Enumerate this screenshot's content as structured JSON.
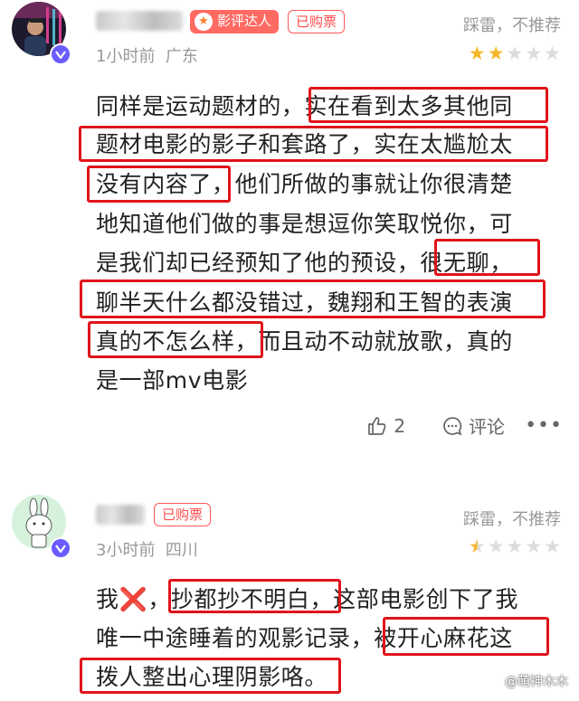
{
  "reviews": [
    {
      "critic_badge": "影评达人",
      "bought_badge": "已购票",
      "time": "1小时前",
      "location": "广东",
      "rating_text": "踩雷，不推荐",
      "stars": [
        1,
        1,
        0,
        0,
        0
      ],
      "lines": [
        "同样是运动题材的，实在看到太多其他同",
        "题材电影的影子和套路了，实在太尴尬太",
        "没有内容了，他们所做的事就让你很清楚",
        "地知道他们做的事是想逗你笑取悦你，可",
        "是我们却已经预知了他的预设，很无聊，",
        "聊半天什么都没错过，魏翔和王智的表演",
        "真的不怎么样，而且动不动就放歌，真的",
        "是一部mv电影"
      ],
      "like_count": "2",
      "comment_label": "评论"
    },
    {
      "bought_badge": "已购票",
      "time": "3小时前",
      "location": "四川",
      "rating_text": "踩雷，不推荐",
      "stars": [
        0.5,
        0,
        0,
        0,
        0
      ],
      "lines": [
        "我❌，抄都抄不明白，这部电影创下了我",
        "唯一中途睡着的观影记录，被开心麻花这",
        "拨人整出心理阴影咯。"
      ]
    }
  ],
  "watermark": "@萌神木木",
  "colors": {
    "highlight": "#e0141a",
    "star": "#f5b82a",
    "badge": "#ff6a63"
  }
}
